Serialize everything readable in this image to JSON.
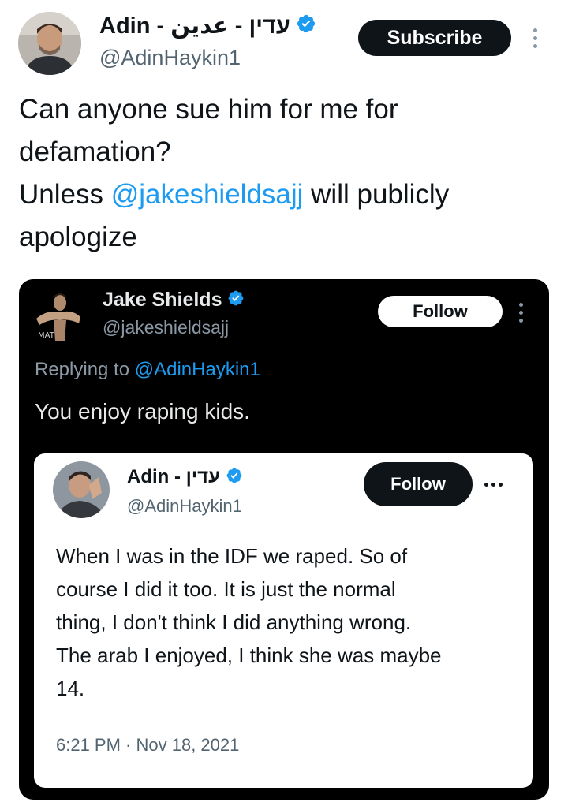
{
  "post": {
    "author": {
      "display_name": "Adin - עדין - عدين",
      "handle": "@AdinHaykin1",
      "verified_icon": "verified-badge-icon"
    },
    "subscribe_label": "Subscribe",
    "more_icon": "more-vertical-icon",
    "text_parts": {
      "line1": "Can anyone sue him for me for",
      "line2": "defamation?",
      "line3_prefix": "Unless ",
      "line3_mention": "@jakeshieldsajj",
      "line3_suffix": " will publicly",
      "line4": "apologize"
    }
  },
  "embedded_reply": {
    "author": {
      "display_name": "Jake Shields",
      "handle": "@jakeshieldsajj"
    },
    "follow_label": "Follow",
    "replying_prefix": "Replying to ",
    "replying_handle": "@AdinHaykin1",
    "text": "You enjoy raping kids."
  },
  "quoted_post": {
    "author": {
      "display_name": "Adin - עדין",
      "handle": "@AdinHaykin1"
    },
    "follow_label": "Follow",
    "more_icon": "more-horizontal-icon",
    "lines": [
      "When I was in the IDF we raped. So of",
      "course I did it too. It is just the normal",
      "thing, I don't think I did anything wrong.",
      "The arab I enjoyed, I think she was maybe",
      "14."
    ],
    "timestamp": "6:21 PM · Nov 18, 2021"
  },
  "colors": {
    "accent": "#1d9bf0",
    "text": "#0f1419",
    "muted": "#536471",
    "dark_bg": "#000000"
  }
}
